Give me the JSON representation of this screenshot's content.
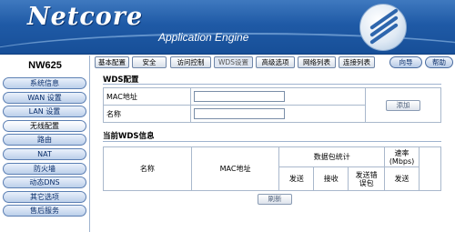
{
  "brand": {
    "logo": "Netcore",
    "subtitle": "Application Engine"
  },
  "device": {
    "model": "NW625"
  },
  "sidebar": {
    "items": [
      {
        "label": "系统信息"
      },
      {
        "label": "WAN 设置"
      },
      {
        "label": "LAN 设置"
      },
      {
        "label": "无线配置",
        "active": true
      },
      {
        "label": "路由"
      },
      {
        "label": "NAT"
      },
      {
        "label": "防火墙"
      },
      {
        "label": "动态DNS"
      },
      {
        "label": "其它选项"
      },
      {
        "label": "售后服务"
      }
    ]
  },
  "tabs": [
    {
      "label": "基本配置"
    },
    {
      "label": "安全"
    },
    {
      "label": "访问控制"
    },
    {
      "label": "WDS设置",
      "active": true
    },
    {
      "label": "高级选项"
    },
    {
      "label": "网络列表"
    },
    {
      "label": "连接列表"
    }
  ],
  "header_buttons": {
    "guide": "向导",
    "help": "帮助"
  },
  "wds_config": {
    "title": "WDS配置",
    "mac_label": "MAC地址",
    "name_label": "名称",
    "mac_value": "",
    "name_value": "",
    "add_button": "添加"
  },
  "wds_info": {
    "title": "当前WDS信息",
    "headers": {
      "name": "名称",
      "mac": "MAC地址",
      "packet_stats": "数据包统计",
      "send": "发送",
      "receive": "接收",
      "send_error_line1": "发送错",
      "send_error_line2": "误包",
      "rate_line1": "速率",
      "rate_line2": "(Mbps)",
      "rate_send": "发送"
    },
    "refresh_button": "刷新"
  },
  "colors": {
    "header_blue": "#1f5aa6",
    "border": "#a9b8cc",
    "nav_border": "#5b7fb3"
  }
}
